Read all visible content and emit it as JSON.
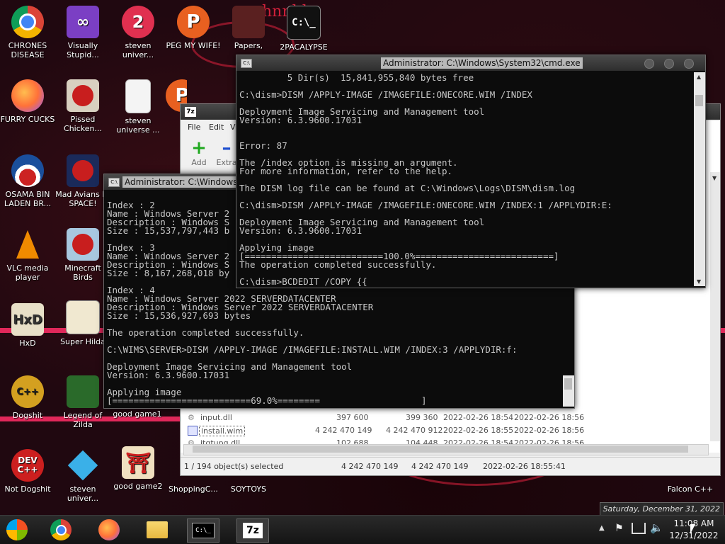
{
  "desktop": {
    "icons": [
      {
        "label": "CHRONES DISEASE"
      },
      {
        "label": "Visually Stupid..."
      },
      {
        "label": "steven univer..."
      },
      {
        "label": "PEG MY WIFE!"
      },
      {
        "label": "Papers,"
      },
      {
        "label": "2PACALYPSE"
      },
      {
        "label": "FURRY CUCKS"
      },
      {
        "label": "Pissed Chicken..."
      },
      {
        "label": "steven universe ..."
      },
      {
        "label": "OSAMA BIN LADEN BR..."
      },
      {
        "label": "Mad Avians IN SPACE!"
      },
      {
        "label": "VLC media player"
      },
      {
        "label": "Minecraft Birds"
      },
      {
        "label": "HxD"
      },
      {
        "label": "Super Hilda"
      },
      {
        "label": "Dogshit"
      },
      {
        "label": "Legend of Zilda"
      },
      {
        "label": "good game1"
      },
      {
        "label": "Not Dogshit"
      },
      {
        "label": "steven univer..."
      },
      {
        "label": "good game2"
      },
      {
        "label": "ShoppingC..."
      },
      {
        "label": "SOYTOYS"
      },
      {
        "label": "Falcon C++"
      }
    ],
    "scribble_text": "hnnhh.."
  },
  "cmd_main": {
    "title": "Administrator: C:\\Windows\\System32\\cmd.exe",
    "lines": [
      "         5 Dir(s)  15,841,955,840 bytes free",
      "",
      "C:\\dism>DISM /APPLY-IMAGE /IMAGEFILE:ONECORE.WIM /INDEX",
      "",
      "Deployment Image Servicing and Management tool",
      "Version: 6.3.9600.17031",
      "",
      "",
      "Error: 87",
      "",
      "The /index option is missing an argument.",
      "For more information, refer to the help.",
      "",
      "The DISM log file can be found at C:\\Windows\\Logs\\DISM\\dism.log",
      "",
      "C:\\dism>DISM /APPLY-IMAGE /IMAGEFILE:ONECORE.WIM /INDEX:1 /APPLYDIR:E:",
      "",
      "Deployment Image Servicing and Management tool",
      "Version: 6.3.9600.17031",
      "",
      "Applying image",
      "[==========================100.0%==========================]",
      "The operation completed successfully.",
      "",
      "C:\\dism>BCDEDIT /COPY {{"
    ]
  },
  "cmd_second": {
    "title": "Administrator: C:\\Windows\\S",
    "lines": [
      "",
      "Index : 2",
      "Name : Windows Server 2",
      "Description : Windows S",
      "Size : 15,537,797,443 b",
      "",
      "Index : 3",
      "Name : Windows Server 2",
      "Description : Windows S",
      "Size : 8,167,268,018 by",
      "",
      "Index : 4",
      "Name : Windows Server 2022 SERVERDATACENTER",
      "Description : Windows Server 2022 SERVERDATACENTER",
      "Size : 15,536,927,693 bytes",
      "",
      "The operation completed successfully.",
      "",
      "C:\\WIMS\\SERVER>DISM /APPLY-IMAGE /IMAGEFILE:INSTALL.WIM /INDEX:3 /APPLYDIR:f:",
      "",
      "Deployment Image Servicing and Management tool",
      "Version: 6.3.9600.17031",
      "",
      "Applying image",
      "[==========================69.0%========                   ]"
    ]
  },
  "sevenzip": {
    "title_icon": "7z",
    "menu": [
      "File",
      "Edit",
      "V"
    ],
    "toolbar": {
      "add": "Add",
      "extract": "Extra"
    },
    "files": [
      {
        "name": "input.dll",
        "size": "397 600",
        "packed": "399 360",
        "modified": "2022-02-26 18:54",
        "created": "2022-02-26 18:56"
      },
      {
        "name": "install.wim",
        "size": "4 242 470 149",
        "packed": "4 242 470 912",
        "modified": "2022-02-26 18:55",
        "created": "2022-02-26 18:56"
      },
      {
        "name": "itgtupg.dll",
        "size": "102 688",
        "packed": "104 448",
        "modified": "2022-02-26 18:54",
        "created": "2022-02-26 18:56"
      }
    ],
    "status": {
      "selected": "1 / 194 object(s) selected",
      "size": "4 242 470 149",
      "packed": "4 242 470 149",
      "date": "2022-02-26 18:55:41"
    }
  },
  "taskbar": {
    "items": [
      "chrome",
      "firefox",
      "explorer",
      "cmd",
      "7-zip"
    ],
    "cmd_icon_text": "C:\\_",
    "sevenzip_icon_text": "7z",
    "time": "11:08 AM",
    "date": "12/31/2022",
    "tooltip": "Saturday, December 31, 2022"
  },
  "colors": {
    "console_bg": "#0c0c0c",
    "console_text": "#c8c8c8",
    "accent": "#e0285a"
  }
}
